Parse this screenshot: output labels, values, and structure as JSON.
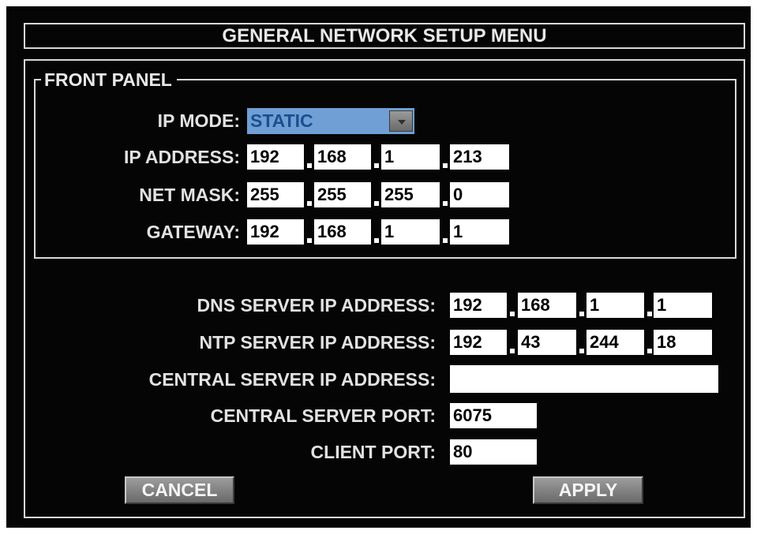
{
  "title": "GENERAL NETWORK SETUP MENU",
  "front_panel": {
    "legend": "FRONT PANEL",
    "ip_mode": {
      "label": "IP MODE:",
      "value": "STATIC",
      "dropdown_icon": "chevron-down-icon"
    },
    "ip_address": {
      "label": "IP ADDRESS:",
      "octets": [
        "192",
        "168",
        "1",
        "213"
      ]
    },
    "net_mask": {
      "label": "NET MASK:",
      "octets": [
        "255",
        "255",
        "255",
        "0"
      ]
    },
    "gateway": {
      "label": "GATEWAY:",
      "octets": [
        "192",
        "168",
        "1",
        "1"
      ]
    }
  },
  "dns_server": {
    "label": "DNS SERVER IP ADDRESS:",
    "octets": [
      "192",
      "168",
      "1",
      "1"
    ]
  },
  "ntp_server": {
    "label": "NTP SERVER IP ADDRESS:",
    "octets": [
      "192",
      "43",
      "244",
      "18"
    ]
  },
  "central_server": {
    "label": "CENTRAL SERVER IP ADDRESS:",
    "value": ""
  },
  "central_server_port": {
    "label": "CENTRAL SERVER PORT:",
    "value": "6075"
  },
  "client_port": {
    "label": "CLIENT PORT:",
    "value": "80"
  },
  "buttons": {
    "cancel": "CANCEL",
    "apply": "APPLY"
  },
  "colors": {
    "background": "#050505",
    "border": "#d8d8d8",
    "text": "#e2e2e2",
    "field_bg": "#ffffff",
    "select_bg": "#6f9fd4",
    "select_text": "#1b4f8f",
    "button": "#8a8a8a"
  }
}
